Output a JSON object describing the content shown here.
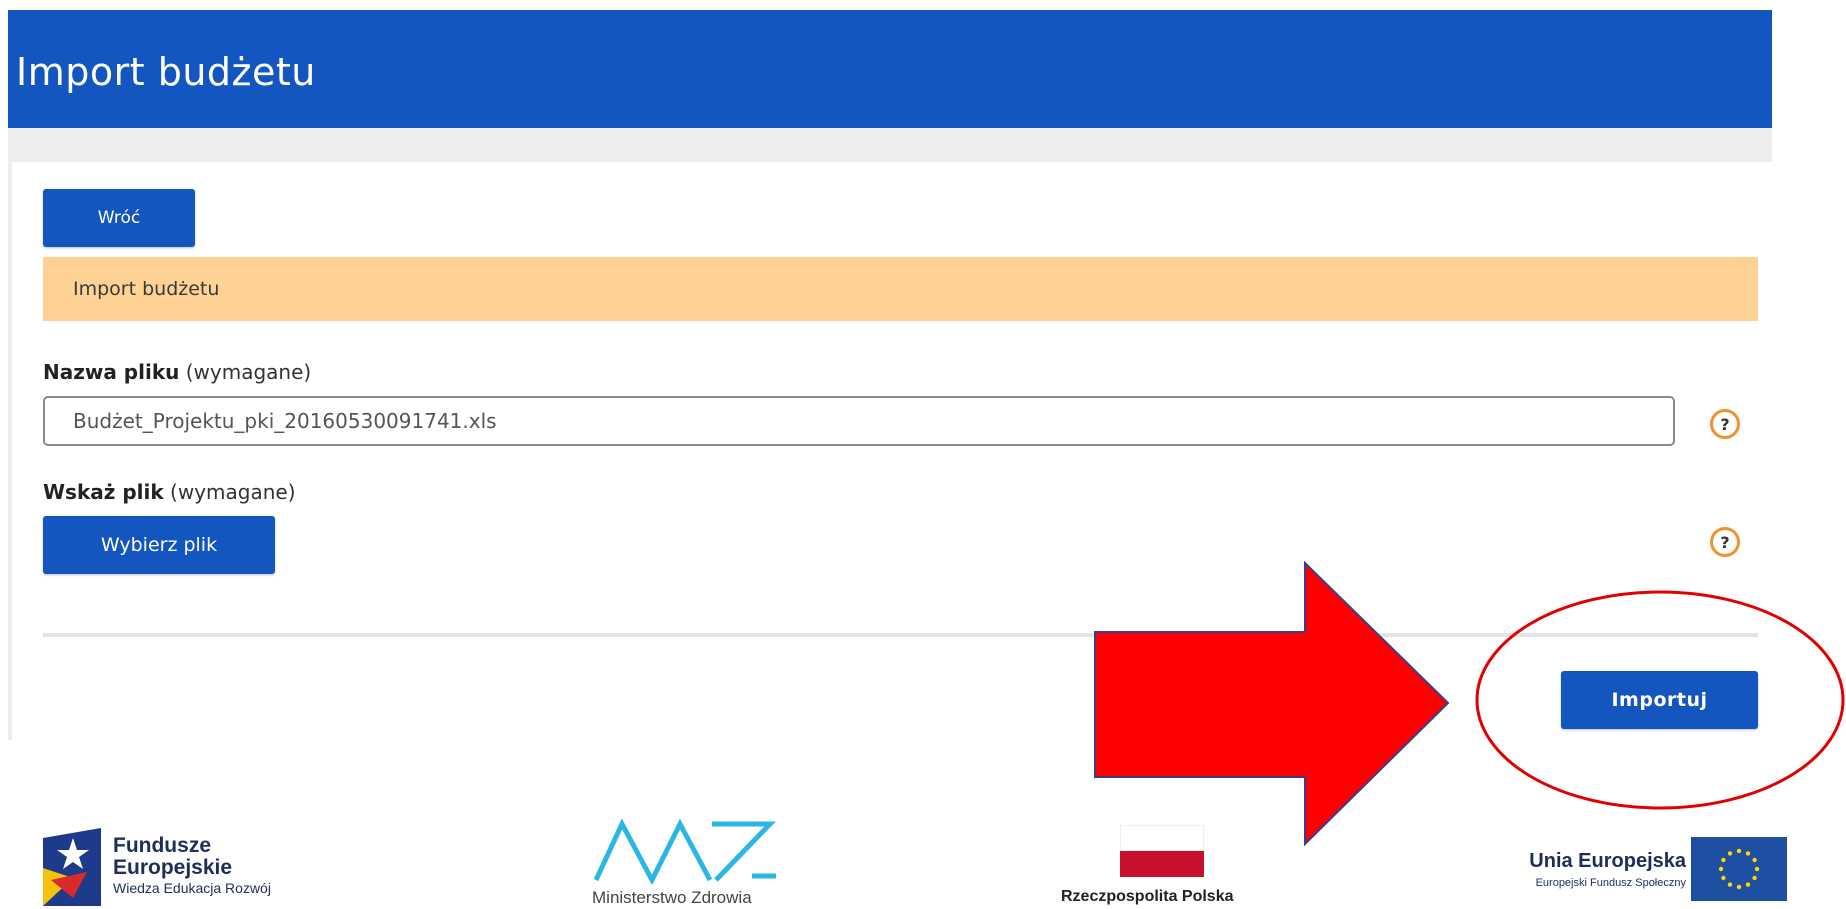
{
  "header": {
    "title": "Import budżetu"
  },
  "toolbar": {
    "back_label": "Wróć"
  },
  "section": {
    "title": "Import budżetu"
  },
  "form": {
    "filename": {
      "label_bold": "Nazwa pliku",
      "label_note": " (wymagane)",
      "value": "Budżet_Projektu_pki_20160530091741.xls"
    },
    "file": {
      "label_bold": "Wskaż plik",
      "label_note": " (wymagane)",
      "choose_label": "Wybierz plik"
    },
    "help_glyph": "?"
  },
  "actions": {
    "import_label": "Importuj"
  },
  "annotation": {
    "arrow_color": "#ff0000",
    "circle_color": "#e00000"
  },
  "footer": {
    "fe": {
      "line1": "Fundusze",
      "line2": "Europejskie",
      "line3": "Wiedza Edukacja Rozwój"
    },
    "mz": {
      "name": "Ministerstwo Zdrowia"
    },
    "rp": {
      "name": "Rzeczpospolita  Polska"
    },
    "ue": {
      "line1": "Unia Europejska",
      "line2": "Europejski Fundusz Społeczny"
    }
  },
  "colors": {
    "primary": "#1456c0",
    "section_bg": "#fed194",
    "help_border": "#f0922b",
    "flag_red": "#c8102e",
    "eu_blue": "#1e4fa3",
    "eu_star": "#ffd800"
  }
}
